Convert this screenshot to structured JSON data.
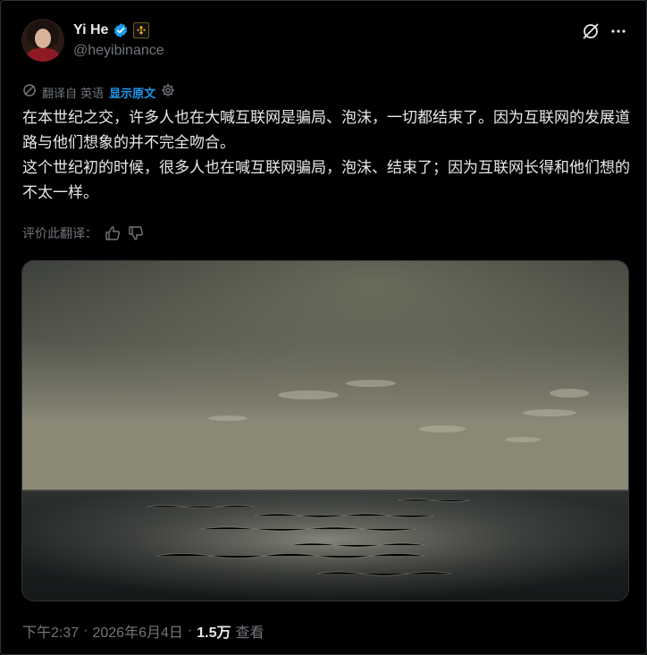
{
  "author": {
    "name": "Yi He",
    "handle": "@heyibinance"
  },
  "translation": {
    "label": "翻译自 英语",
    "show_original": "显示原文"
  },
  "post": {
    "text": "在本世纪之交，许多人也在大喊互联网是骗局、泡沫，一切都结束了。因为互联网的发展道路与他们想象的并不完全吻合。\n这个世纪初的时候，很多人也在喊互联网骗局，泡沫、结束了；因为互联网长得和他们想的不太一样。"
  },
  "rating": {
    "label": "评价此翻译："
  },
  "meta": {
    "time": "下午2:37",
    "sep1": "·",
    "date": "2026年6月4日",
    "sep2": "·",
    "views_count": "1.5万",
    "views_label": "查看"
  },
  "colors": {
    "background": "#000000",
    "text": "#e7e9ea",
    "muted": "#71767b",
    "accent": "#1d9bf0",
    "border": "#2f3336"
  },
  "icons": {
    "verified": "verified-badge-icon",
    "affiliate": "binance-affiliate-icon",
    "grok": "grok-icon",
    "more": "more-icon",
    "translate": "translate-icon",
    "settings": "gear-icon",
    "thumbs_up": "thumbs-up-icon",
    "thumbs_down": "thumbs-down-icon"
  }
}
